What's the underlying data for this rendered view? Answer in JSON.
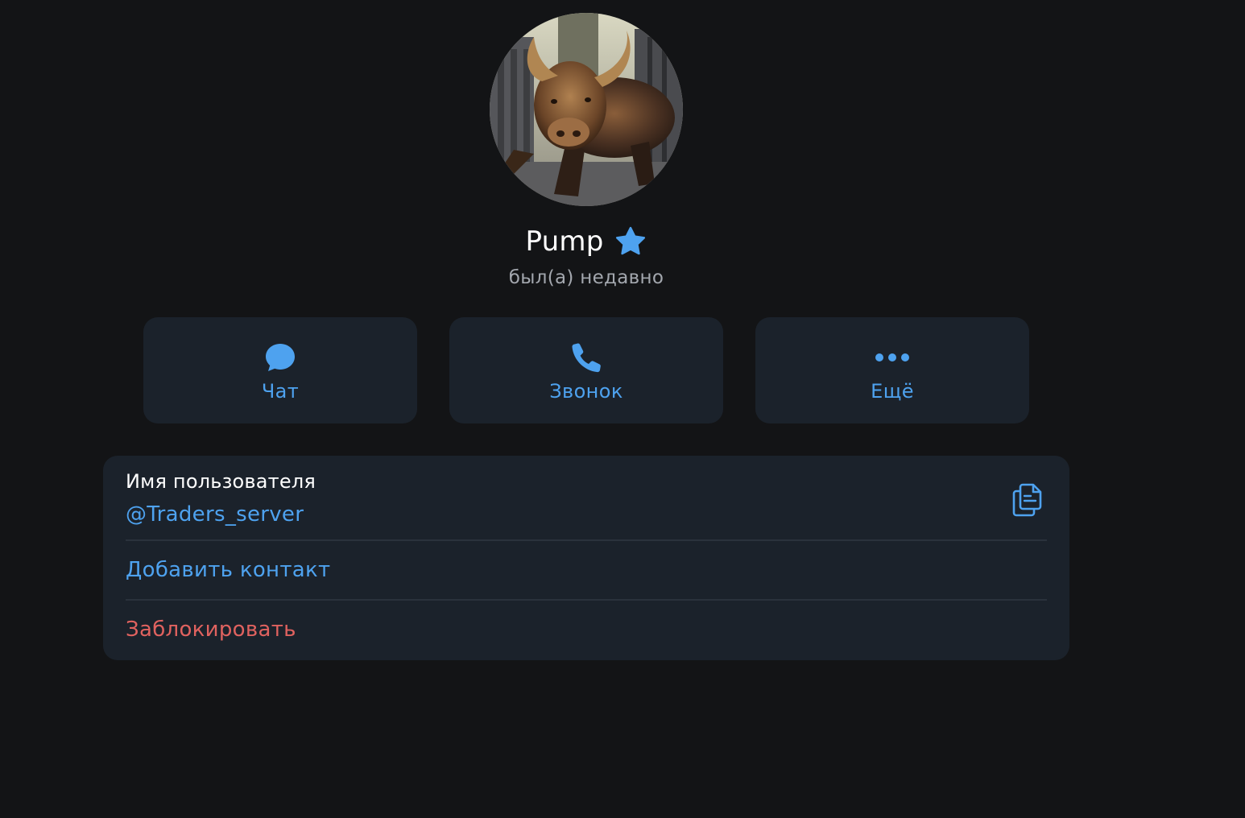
{
  "profile": {
    "name": "Pump",
    "status": "был(а) недавно",
    "badge_icon": "premium-star-icon",
    "avatar_icon": "bull-statue-photo"
  },
  "actions": {
    "chat": {
      "label": "Чат",
      "icon": "chat-bubble-icon"
    },
    "call": {
      "label": "Звонок",
      "icon": "phone-icon"
    },
    "more": {
      "label": "Ещё",
      "icon": "more-dots-icon"
    }
  },
  "info": {
    "username_label": "Имя пользователя",
    "username_value": "@Traders_server",
    "copy_icon": "copy-icon",
    "add_contact": "Добавить контакт",
    "block": "Заблокировать"
  },
  "colors": {
    "background": "#131416",
    "card": "#1b222b",
    "accent": "#4ea2ef",
    "danger": "#e0625f",
    "text_primary": "#ffffff",
    "text_secondary": "#a3a7ae"
  }
}
